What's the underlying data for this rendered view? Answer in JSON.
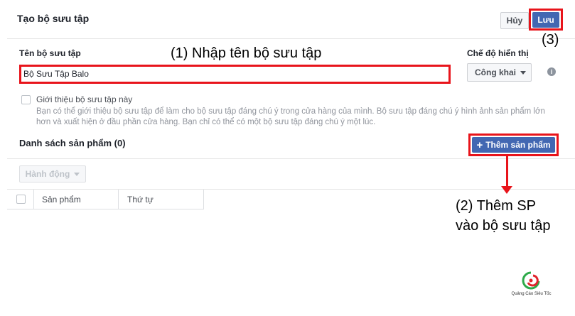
{
  "header": {
    "title": "Tạo bộ sưu tập",
    "cancel_label": "Hủy",
    "save_label": "Lưu"
  },
  "form": {
    "name_label": "Tên bộ sưu tập",
    "name_value": "Bộ Sưu Tập Balo",
    "visibility_label": "Chế độ hiển thị",
    "visibility_value": "Công khai",
    "feature_label": "Giới thiệu bộ sưu tập này",
    "feature_description": "Bạn có thể giới thiệu bộ sưu tập để làm cho bộ sưu tập đáng chú ý trong cửa hàng của mình. Bộ sưu tập đáng chú ý hình ảnh sản phẩm lớn hơn và xuất hiện ở đầu phần cửa hàng. Bạn chỉ có thể có một bộ sưu tập đáng chú ý một lúc."
  },
  "products": {
    "title": "Danh sách sản phẩm (0)",
    "add_label": "Thêm sản phẩm",
    "action_label": "Hành động",
    "columns": [
      "Sản phẩm",
      "Thứ tự"
    ]
  },
  "annotations": {
    "step1": "(1) Nhập tên bộ sưu tập",
    "step2_line1": "(2) Thêm SP",
    "step2_line2": "vào bộ sưu tập",
    "step3": "(3)"
  },
  "logo": {
    "text": "Quảng Cáo Siêu Tốc"
  },
  "colors": {
    "primary": "#4267b2",
    "highlight": "#e8141b"
  }
}
